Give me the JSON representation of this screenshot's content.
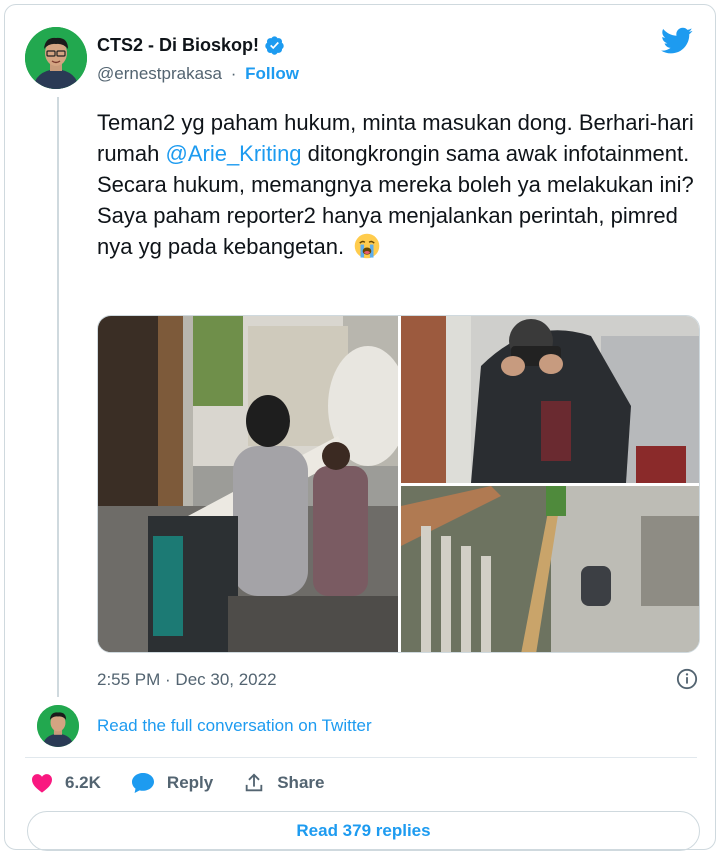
{
  "author": {
    "display_name": "CTS2 - Di Bioskop!",
    "handle": "@ernestprakasa",
    "follow_label": "Follow",
    "separator": "·"
  },
  "tweet": {
    "text_before": "Teman2 yg paham hukum, minta masukan dong. Berhari-hari rumah ",
    "mention": "@Arie_Kriting",
    "text_after": " ditongkrongin sama awak infotainment. Secara hukum, memangnya mereka boleh ya melakukan ini? Saya paham reporter2 hanya menjalankan perintah, pimred nya yg pada kebangetan.",
    "emoji": "loudly-crying-face",
    "timestamp": "2:55 PM · Dec 30, 2022"
  },
  "conversation_link": "Read the full conversation on Twitter",
  "actions": {
    "like_count": "6.2K",
    "reply_label": "Reply",
    "share_label": "Share"
  },
  "read_replies_label": "Read 379 replies",
  "colors": {
    "accent": "#1d9bf0",
    "like": "#f91880",
    "text": "#0f1419",
    "muted": "#536471"
  }
}
